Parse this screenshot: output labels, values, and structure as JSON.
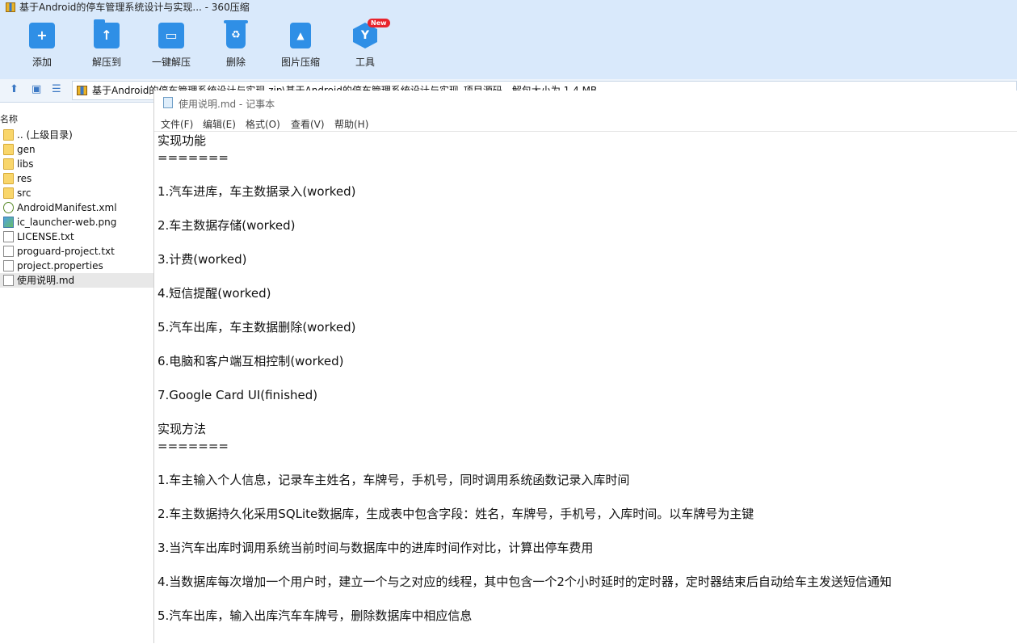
{
  "window": {
    "title": "基于Android的停车管理系统设计与实现... - 360压缩"
  },
  "toolbar": {
    "items": [
      {
        "label": "添加",
        "icon": "add-icon"
      },
      {
        "label": "解压到",
        "icon": "extract-to-icon"
      },
      {
        "label": "一键解压",
        "icon": "one-click-extract-icon"
      },
      {
        "label": "删除",
        "icon": "delete-icon"
      },
      {
        "label": "图片压缩",
        "icon": "image-compress-icon"
      },
      {
        "label": "工具",
        "icon": "tools-icon"
      }
    ],
    "new_badge": "New"
  },
  "address": {
    "text": "基于Android的停车管理系统设计与实现.zip\\基于Android的停车管理系统设计与实现_项目源码 - 解包大小为 1.4 MB"
  },
  "file_panel": {
    "column_header": "名称",
    "items": [
      {
        "name": ".. (上级目录)",
        "type": "folder"
      },
      {
        "name": "gen",
        "type": "folder"
      },
      {
        "name": "libs",
        "type": "folder"
      },
      {
        "name": "res",
        "type": "folder"
      },
      {
        "name": "src",
        "type": "folder"
      },
      {
        "name": "AndroidManifest.xml",
        "type": "xml"
      },
      {
        "name": "ic_launcher-web.png",
        "type": "image"
      },
      {
        "name": "LICENSE.txt",
        "type": "file"
      },
      {
        "name": "proguard-project.txt",
        "type": "file"
      },
      {
        "name": "project.properties",
        "type": "file"
      },
      {
        "name": "使用说明.md",
        "type": "file",
        "selected": true
      }
    ]
  },
  "notepad": {
    "title": "使用说明.md - 记事本",
    "menu": [
      "文件(F)",
      "编辑(E)",
      "格式(O)",
      "查看(V)",
      "帮助(H)"
    ],
    "lines": [
      "实现功能",
      "=======",
      "1.汽车进库，车主数据录入(worked)",
      "2.车主数据存储(worked)",
      "3.计费(worked)",
      "4.短信提醒(worked)",
      "5.汽车出库，车主数据删除(worked)",
      "6.电脑和客户端互相控制(worked)",
      "7.Google Card UI(finished)",
      "实现方法",
      "=======",
      "1.车主输入个人信息，记录车主姓名，车牌号，手机号，同时调用系统函数记录入库时间",
      "2.车主数据持久化采用SQLite数据库，生成表中包含字段：姓名，车牌号，手机号，入库时间。以车牌号为主键",
      "3.当汽车出库时调用系统当前时间与数据库中的进库时间作对比，计算出停车费用",
      "4.当数据库每次增加一个用户时，建立一个与之对应的线程，其中包含一个2个小时延时的定时器，定时器结束后自动给车主发送短信通知",
      "5.汽车出库，输入出库汽车车牌号，删除数据库中相应信息"
    ]
  }
}
